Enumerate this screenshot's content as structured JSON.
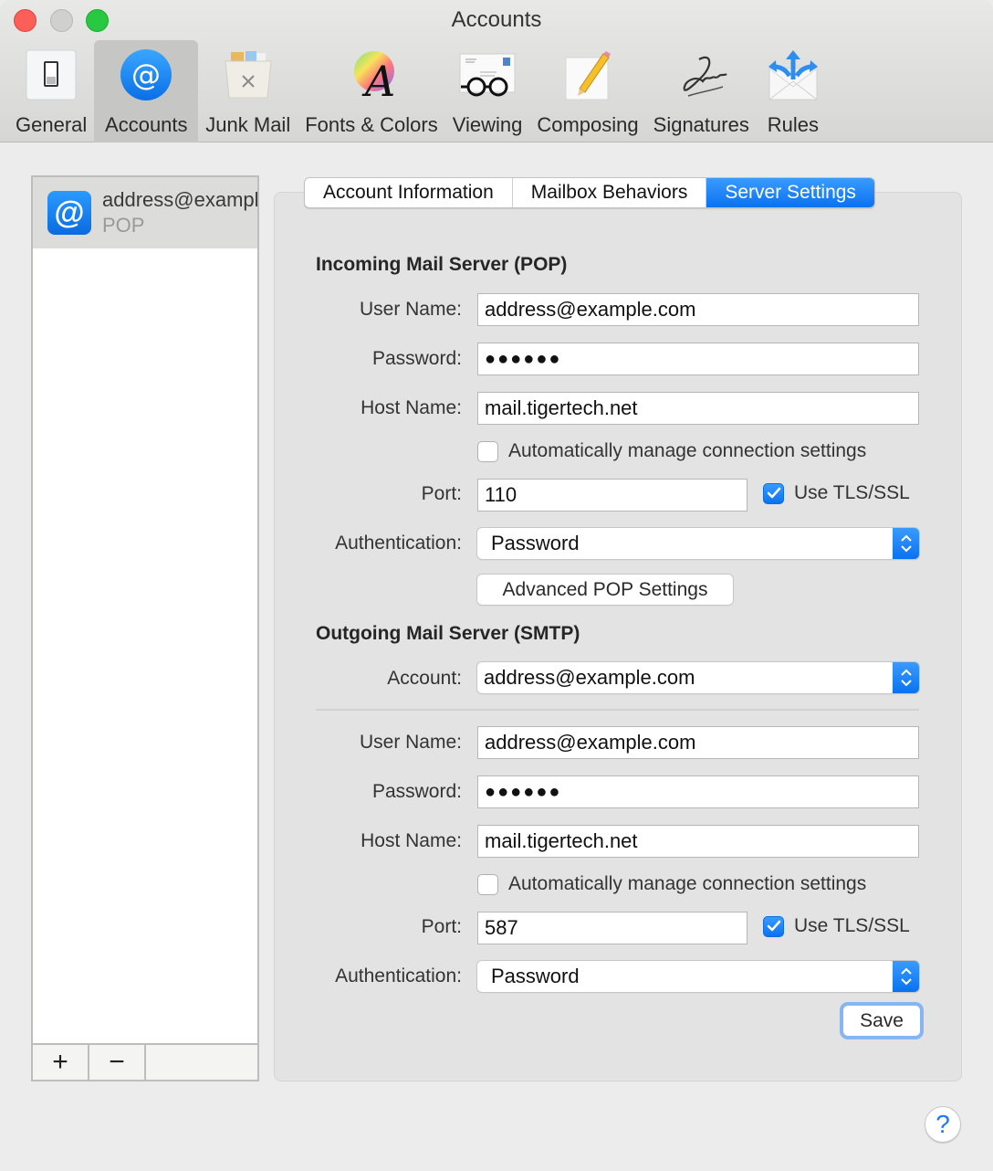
{
  "window": {
    "title": "Accounts",
    "traffic_lights": [
      "close",
      "minimize",
      "zoom"
    ]
  },
  "toolbar": {
    "items": [
      {
        "label": "General",
        "icon": "switch-icon"
      },
      {
        "label": "Accounts",
        "icon": "at-sign-icon",
        "active": true
      },
      {
        "label": "Junk Mail",
        "icon": "trash-can-icon"
      },
      {
        "label": "Fonts & Colors",
        "icon": "font-color-wheel-icon"
      },
      {
        "label": "Viewing",
        "icon": "glasses-letter-icon"
      },
      {
        "label": "Composing",
        "icon": "pencil-paper-icon"
      },
      {
        "label": "Signatures",
        "icon": "signature-icon"
      },
      {
        "label": "Rules",
        "icon": "envelope-arrows-icon"
      }
    ]
  },
  "accounts": {
    "items": [
      {
        "email": "address@example.com",
        "type": "POP",
        "icon": "at-sign-icon"
      }
    ],
    "add_label": "+",
    "remove_label": "−"
  },
  "tabs": {
    "items": [
      {
        "label": "Account Information"
      },
      {
        "label": "Mailbox Behaviors"
      },
      {
        "label": "Server Settings",
        "active": true
      }
    ]
  },
  "incoming": {
    "title": "Incoming Mail Server (POP)",
    "username_label": "User Name:",
    "username": "address@example.com",
    "password_label": "Password:",
    "password": "●●●●●●",
    "hostname_label": "Host Name:",
    "hostname": "mail.tigertech.net",
    "auto_manage_label": "Automatically manage connection settings",
    "auto_manage_checked": false,
    "port_label": "Port:",
    "port": "110",
    "tls_label": "Use TLS/SSL",
    "tls_checked": true,
    "auth_label": "Authentication:",
    "auth_value": "Password",
    "advanced_button": "Advanced POP Settings"
  },
  "outgoing": {
    "title": "Outgoing Mail Server (SMTP)",
    "account_label": "Account:",
    "account_value": "address@example.com",
    "username_label": "User Name:",
    "username": "address@example.com",
    "password_label": "Password:",
    "password": "●●●●●●",
    "hostname_label": "Host Name:",
    "hostname": "mail.tigertech.net",
    "auto_manage_label": "Automatically manage connection settings",
    "auto_manage_checked": false,
    "port_label": "Port:",
    "port": "587",
    "tls_label": "Use TLS/SSL",
    "tls_checked": true,
    "auth_label": "Authentication:",
    "auth_value": "Password"
  },
  "actions": {
    "save_label": "Save",
    "help_label": "?"
  },
  "colors": {
    "accent": "#0a72f0",
    "close": "#fc5f57",
    "minimize": "#d0d0ce",
    "zoom": "#28c840",
    "focus_ring": "#86b6ef"
  }
}
